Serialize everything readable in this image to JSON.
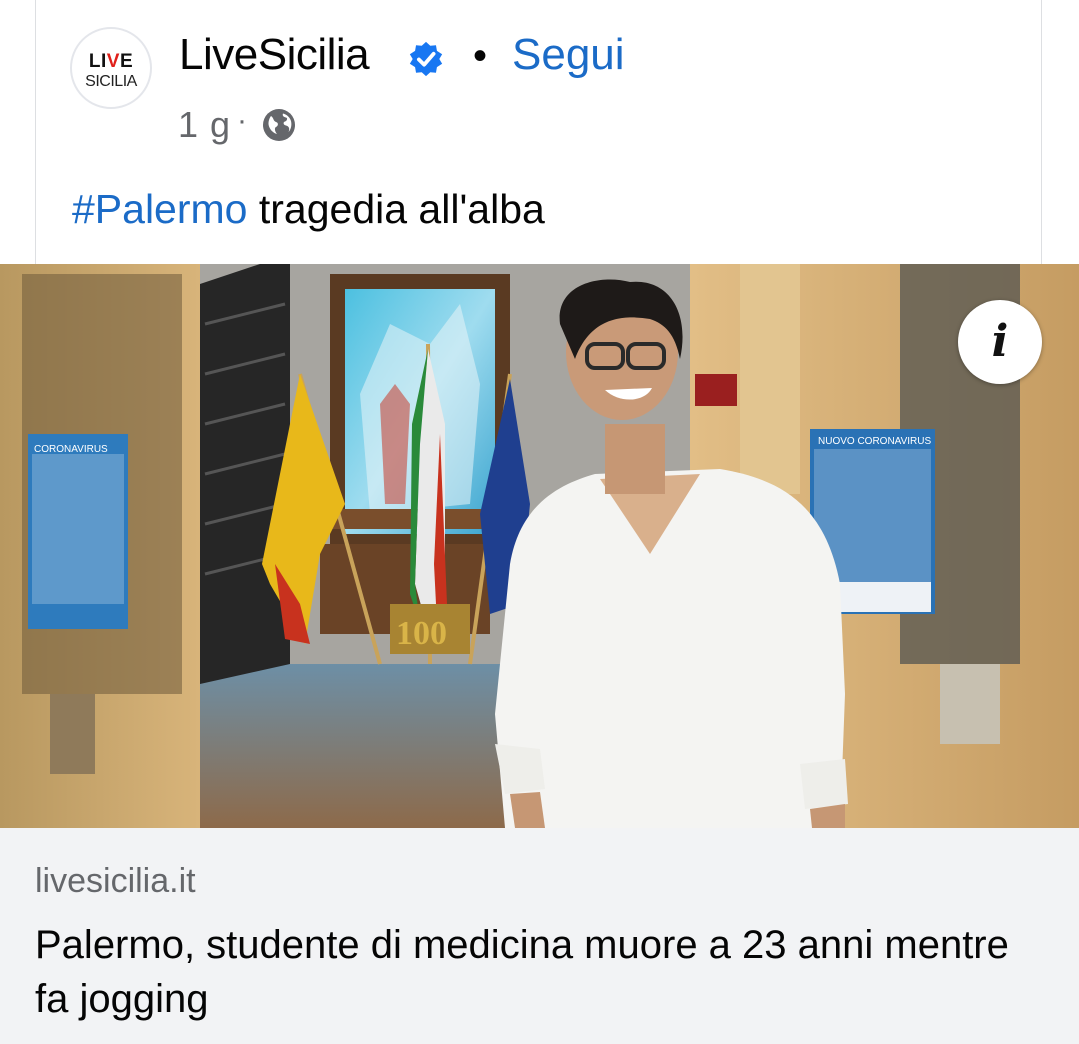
{
  "post": {
    "avatar": {
      "line1_a": "LI",
      "line1_b": "V",
      "line1_c": "E",
      "line2": "SICILIA"
    },
    "page_name": "LiveSicilia",
    "separator": "•",
    "follow_label": "Segui",
    "time": "1 g",
    "time_separator": "·",
    "caption": {
      "hashtag": "#Palermo",
      "text": " tragedia all'alba"
    }
  },
  "link_preview": {
    "domain": "livesicilia.it",
    "headline": "Palermo, studente di medicina muore a 23 anni mentre fa jogging"
  },
  "photo": {
    "left_poster_title": "CORONAVIRUS",
    "right_poster_title": "NUOVO CORONAVIRUS",
    "badge_text": "100"
  },
  "colors": {
    "link_blue": "#1b6bc7",
    "verified_blue": "#1877f2",
    "preview_bg": "#f2f3f5"
  },
  "icons": [
    "verified-badge-icon",
    "globe-icon",
    "info-icon"
  ]
}
